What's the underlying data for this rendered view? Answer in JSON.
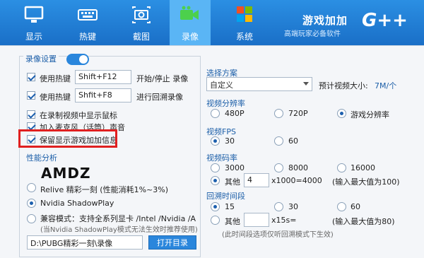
{
  "tabs": [
    {
      "label": "显示",
      "icon": "monitor-icon"
    },
    {
      "label": "热键",
      "icon": "keyboard-icon"
    },
    {
      "label": "截图",
      "icon": "camera-icon"
    },
    {
      "label": "录像",
      "icon": "video-camera-icon",
      "active": true
    },
    {
      "label": "系统",
      "icon": "windows-icon"
    }
  ],
  "brand": {
    "title": "游戏加加",
    "subtitle": "高端玩家必备软件",
    "logo": "G++"
  },
  "recording": {
    "settings_label": "录像设置",
    "toggle_on": true,
    "hotkey_label_1": "使用热键",
    "hotkey_value_1": "Shift+F12",
    "hotkey_action_1": "开始/停止 录像",
    "hotkey_label_2": "使用热键",
    "hotkey_value_2": "Shfit+F8",
    "hotkey_action_2": "进行回溯录像",
    "opt_show_cursor": "在录制视频中显示鼠标",
    "opt_mic": "加入麦克风（话筒）声音",
    "opt_keep_display": "保留显示游戏加加信息",
    "perf_label": "性能分析",
    "amd_logo": "AMDZ",
    "relive_label": "Relive 精彩一刻 (性能消耗1%~3%)",
    "shadowplay_label": "Nvidia ShadowPlay",
    "compat_label": "兼容模式：支持全系列显卡 /Intel /Nvidia /A",
    "compat_note": "(当Nvidia ShadowPlay模式无法生效时推荐使用)",
    "path_value": "D:\\PUBG精彩一刻\\录像",
    "open_dir_button": "打开目录"
  },
  "scheme": {
    "label": "选择方案",
    "selected": "自定义",
    "est_size_label": "预计视频大小:",
    "est_size_value": "7M/个"
  },
  "resolution": {
    "label": "视频分辨率",
    "options": [
      "480P",
      "720P",
      "游戏分辨率"
    ],
    "selected": "游戏分辨率"
  },
  "fps": {
    "label": "视频FPS",
    "options": [
      "30",
      "60"
    ],
    "selected": "30"
  },
  "bitrate": {
    "label": "视频码率",
    "options": [
      "3000",
      "8000",
      "16000"
    ],
    "other_label": "其他",
    "other_value": "4",
    "other_suffix": "x1000=4000",
    "max_note": "(输入最大值为100)",
    "selected": "其他"
  },
  "backtrack": {
    "label": "回溯时间段",
    "options": [
      "15",
      "30",
      "60"
    ],
    "other_label": "其他",
    "other_value": "",
    "other_suffix": "x15s=",
    "max_note": "(输入最大值为80)",
    "note": "(此时间段选项仅听回溯模式下生效)",
    "selected": "15"
  }
}
